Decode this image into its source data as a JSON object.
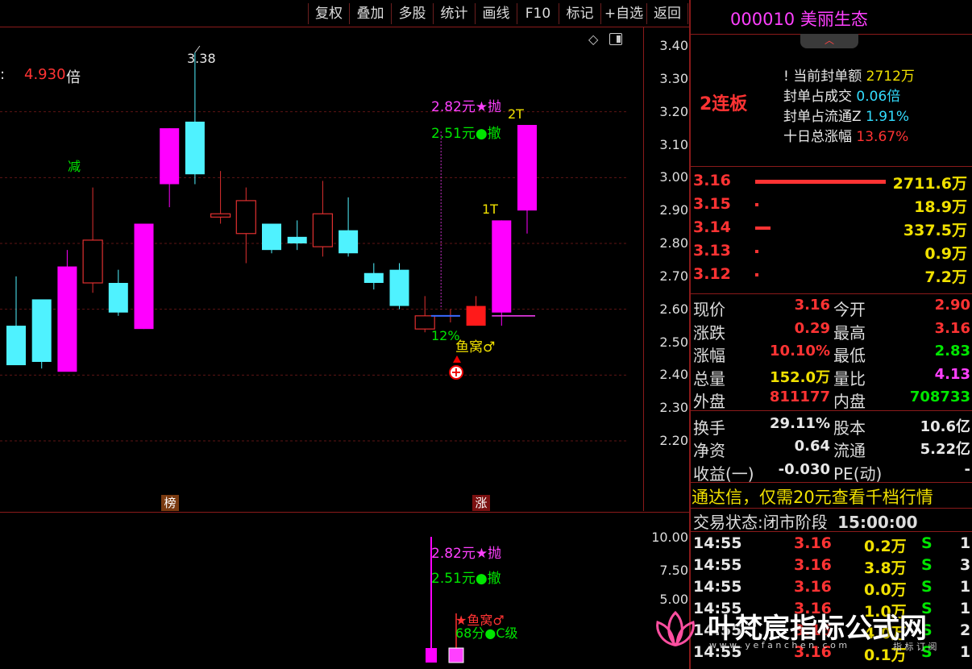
{
  "toolbar": [
    "复权",
    "叠加",
    "多股",
    "统计",
    "画线",
    "F10",
    "标记",
    "+自选",
    "返回"
  ],
  "stock": {
    "code": "000010",
    "name": "美丽生态",
    "board": "2连板"
  },
  "seal_info": [
    {
      "label": "当前封单额",
      "value": "2712万",
      "color": "#f0e000"
    },
    {
      "label": "封单占成交",
      "value": "0.06倍",
      "color": "#33ddff"
    },
    {
      "label": "封单占流通Z",
      "value": "1.91%",
      "color": "#33ddff"
    },
    {
      "label": "十日总涨幅",
      "value": "13.67%",
      "color": "#ff3333"
    }
  ],
  "chart_data": {
    "type": "candlestick",
    "ylim": [
      2.13,
      3.43
    ],
    "y_ticks": [
      "3.40",
      "3.30",
      "3.20",
      "3.10",
      "3.00",
      "2.90",
      "2.80",
      "2.70",
      "2.60",
      "2.50",
      "2.40",
      "2.30",
      "2.20"
    ],
    "candles": [
      {
        "o": 2.43,
        "c": 2.55,
        "h": 2.7,
        "l": 2.48,
        "style": "cyan"
      },
      {
        "o": 2.63,
        "c": 2.44,
        "h": 2.62,
        "l": 2.42,
        "style": "cyan"
      },
      {
        "o": 2.41,
        "c": 2.73,
        "h": 2.78,
        "l": 2.43,
        "style": "mag"
      },
      {
        "o": 2.68,
        "c": 2.81,
        "h": 2.97,
        "l": 2.65,
        "style": "hollow"
      },
      {
        "o": 2.59,
        "c": 2.68,
        "h": 2.72,
        "l": 2.58,
        "style": "cyan"
      },
      {
        "o": 2.54,
        "c": 2.86,
        "h": 2.86,
        "l": 2.54,
        "style": "mag"
      },
      {
        "o": 3.15,
        "c": 2.98,
        "h": 3.15,
        "l": 2.91,
        "style": "mag"
      },
      {
        "o": 3.01,
        "c": 3.17,
        "h": 3.38,
        "l": 2.98,
        "style": "cyan"
      },
      {
        "o": 2.88,
        "c": 2.89,
        "h": 3.02,
        "l": 2.86,
        "style": "hollow"
      },
      {
        "o": 2.83,
        "c": 2.93,
        "h": 2.97,
        "l": 2.74,
        "style": "hollow"
      },
      {
        "o": 2.86,
        "c": 2.78,
        "h": 2.86,
        "l": 2.77,
        "style": "cyan"
      },
      {
        "o": 2.82,
        "c": 2.8,
        "h": 2.87,
        "l": 2.78,
        "style": "cyan"
      },
      {
        "o": 2.79,
        "c": 2.89,
        "h": 2.99,
        "l": 2.76,
        "style": "hollow"
      },
      {
        "o": 2.84,
        "c": 2.77,
        "h": 2.94,
        "l": 2.76,
        "style": "cyan"
      },
      {
        "o": 2.71,
        "c": 2.68,
        "h": 2.74,
        "l": 2.66,
        "style": "cyan"
      },
      {
        "o": 2.72,
        "c": 2.61,
        "h": 2.74,
        "l": 2.6,
        "style": "cyan"
      },
      {
        "o": 2.54,
        "c": 2.58,
        "h": 2.64,
        "l": 2.53,
        "style": "hollow"
      },
      {
        "o": 2.58,
        "c": 2.58,
        "h": 2.6,
        "l": 2.56,
        "style": "flat"
      },
      {
        "o": 2.55,
        "c": 2.61,
        "h": 2.64,
        "l": 2.55,
        "style": "red"
      },
      {
        "o": 2.59,
        "c": 2.87,
        "h": 2.87,
        "l": 2.55,
        "style": "mag"
      },
      {
        "o": 2.9,
        "c": 3.16,
        "h": 3.16,
        "l": 2.83,
        "style": "mag"
      }
    ],
    "annotations": {
      "high": "3.38",
      "left_ratio_value": "4.930",
      "left_ratio_unit": "倍",
      "jian": "减",
      "price_282": "2.82元★抛",
      "price_251": "2.51元●撤",
      "t1": "1T",
      "t2": "2T",
      "pct": "12%",
      "yuwo": "鱼窝♂",
      "bang": "榜",
      "zhang": "涨"
    },
    "sub_ticks": [
      "10.00",
      "7.50",
      "5.00"
    ],
    "sub_annotations": {
      "a1": "2.82元★抛",
      "a2": "2.51元●撤",
      "a3": "★鱼窝♂",
      "a4": "68分●C级"
    }
  },
  "order_book": [
    {
      "price": "3.16",
      "vol": "2711.6万",
      "bar": 1.0
    },
    {
      "price": "3.15",
      "vol": "18.9万",
      "bar": 0.0
    },
    {
      "price": "3.14",
      "vol": "337.5万",
      "bar": 0.12
    },
    {
      "price": "3.13",
      "vol": "0.9万",
      "bar": 0.0
    },
    {
      "price": "3.12",
      "vol": "7.2万",
      "bar": 0.0
    }
  ],
  "quote": [
    {
      "l1": "现价",
      "v1": "3.16",
      "c1": "#ff3333",
      "l2": "今开",
      "v2": "2.90",
      "c2": "#ff3333"
    },
    {
      "l1": "涨跌",
      "v1": "0.29",
      "c1": "#ff3333",
      "l2": "最高",
      "v2": "3.16",
      "c2": "#ff3333"
    },
    {
      "l1": "涨幅",
      "v1": "10.10%",
      "c1": "#ff3333",
      "l2": "最低",
      "v2": "2.83",
      "c2": "#00e600"
    },
    {
      "l1": "总量",
      "v1": "152.0万",
      "c1": "#f0e000",
      "l2": "量比",
      "v2": "4.13",
      "c2": "#ff40ff"
    },
    {
      "l1": "外盘",
      "v1": "811177",
      "c1": "#ff3333",
      "l2": "内盘",
      "v2": "708733",
      "c2": "#00e600"
    },
    {
      "l1": "换手",
      "v1": "29.11%",
      "c1": "#e8e8e8",
      "l2": "股本",
      "v2": "10.6亿",
      "c2": "#e8e8e8"
    },
    {
      "l1": "净资",
      "v1": "0.64",
      "c1": "#e8e8e8",
      "l2": "流通",
      "v2": "5.22亿",
      "c2": "#e8e8e8"
    },
    {
      "l1": "收益(一)",
      "v1": "-0.030",
      "c1": "#e8e8e8",
      "l2": "PE(动)",
      "v2": "-",
      "c2": "#e8e8e8"
    }
  ],
  "promo": "通达信，仅需20元查看千档行情",
  "status": {
    "label": "交易状态:",
    "value": "闭市阶段",
    "time": "15:00:00"
  },
  "ticks": [
    {
      "t": "14:55",
      "p": "3.16",
      "v": "0.2万",
      "s": "S",
      "n": "1"
    },
    {
      "t": "14:55",
      "p": "3.16",
      "v": "3.8万",
      "s": "S",
      "n": "3"
    },
    {
      "t": "14:55",
      "p": "3.16",
      "v": "0.0万",
      "s": "S",
      "n": "1"
    },
    {
      "t": "14:55",
      "p": "3.16",
      "v": "1.0万",
      "s": "S",
      "n": "1"
    },
    {
      "t": "14:55",
      "p": "3.16",
      "v": "4.0万",
      "s": "S",
      "n": "2"
    },
    {
      "t": "14:55",
      "p": "3.16",
      "v": "0.1万",
      "s": "S",
      "n": "1"
    }
  ],
  "watermark": {
    "title": "叶梵宸指标公式网",
    "url": "w w w . y e f a n c h e n . c o m",
    "tag": "指 标 订 阅"
  }
}
